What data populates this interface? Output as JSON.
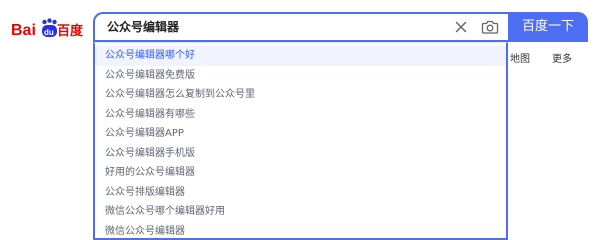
{
  "logo": {
    "text_bai": "Bai",
    "text_du": "du",
    "text_cn": "百度"
  },
  "search": {
    "query": "公众号编辑器",
    "button_label": "百度一下"
  },
  "top_links": [
    "地图",
    "更多"
  ],
  "suggestions": [
    "公众号编辑器哪个好",
    "公众号编辑器免费版",
    "公众号编辑器怎么复制到公众号里",
    "公众号编辑器有哪些",
    "公众号编辑器APP",
    "公众号编辑器手机版",
    "好用的公众号编辑器",
    "公众号排版编辑器",
    "微信公众号哪个编辑器好用",
    "微信公众号编辑器"
  ],
  "colors": {
    "accent": "#4e6ef2",
    "logo_red": "#e10602",
    "logo_blue": "#2932e1",
    "highlight_text": "#315efb"
  },
  "icons": [
    "clear-icon",
    "camera-icon",
    "paw-icon"
  ]
}
